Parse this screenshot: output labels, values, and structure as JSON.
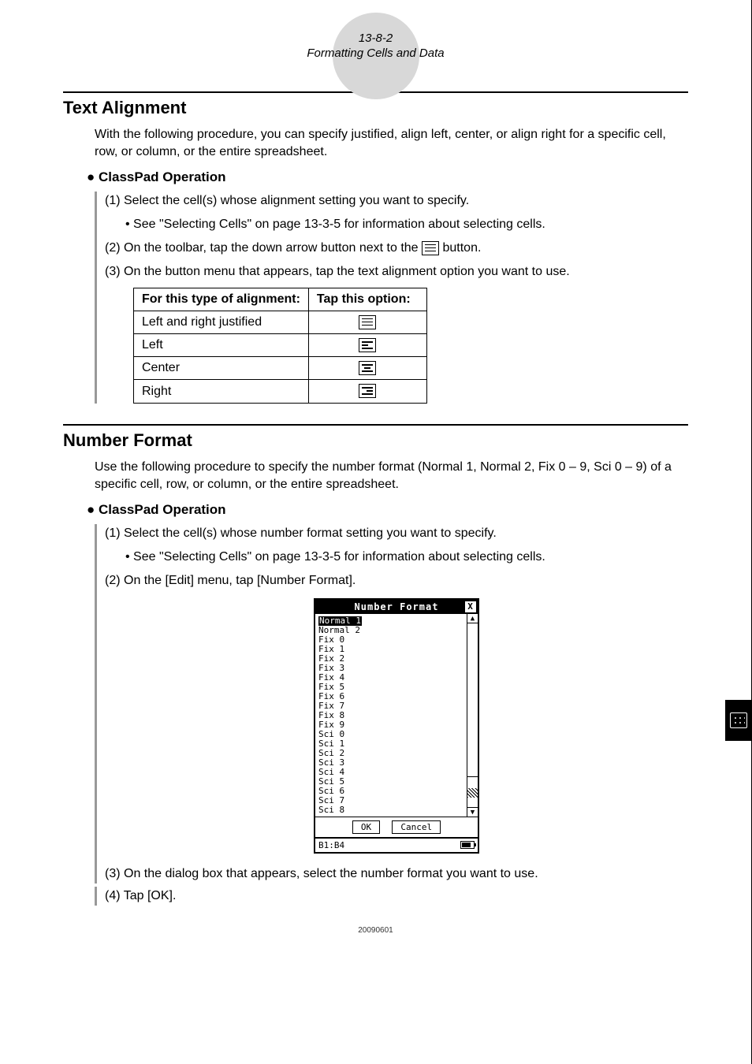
{
  "header": {
    "page_num": "13-8-2",
    "subtitle": "Formatting Cells and Data"
  },
  "section1": {
    "heading": "Text Alignment",
    "intro": "With the following procedure, you can specify justified, align left, center, or align right for a specific cell, row, or column, or the entire spreadsheet.",
    "op_heading": "ClassPad Operation",
    "step1": "(1) Select the cell(s) whose alignment setting you want to specify.",
    "step1_sub": "See \"Selecting Cells\" on page 13-3-5 for information about selecting cells.",
    "step2_a": "(2) On the toolbar, tap the down arrow button next to the ",
    "step2_b": " button.",
    "step3": "(3) On the button menu that appears, tap the text alignment option you want to use.",
    "table": {
      "h1": "For this type of alignment:",
      "h2": "Tap this option:",
      "r1": "Left and right justified",
      "r2": "Left",
      "r3": "Center",
      "r4": "Right"
    }
  },
  "section2": {
    "heading": "Number Format",
    "intro": "Use the following procedure to specify the number format (Normal 1, Normal 2, Fix 0 – 9, Sci 0 – 9) of a specific cell, row, or column, or the entire spreadsheet.",
    "op_heading": "ClassPad Operation",
    "step1": "(1) Select the cell(s) whose number format setting you want to specify.",
    "step1_sub": "See \"Selecting Cells\" on page 13-3-5 for information about selecting cells.",
    "step2": "(2) On the [Edit] menu, tap [Number Format].",
    "step3": "(3) On the dialog box that appears, select the number format you want to use.",
    "step4": "(4) Tap [OK]."
  },
  "dialog": {
    "title": "Number Format",
    "items": [
      "Normal 1",
      "Normal 2",
      "Fix 0",
      "Fix 1",
      "Fix 2",
      "Fix 3",
      "Fix 4",
      "Fix 5",
      "Fix 6",
      "Fix 7",
      "Fix 8",
      "Fix 9",
      "Sci 0",
      "Sci 1",
      "Sci 2",
      "Sci 3",
      "Sci 4",
      "Sci 5",
      "Sci 6",
      "Sci 7",
      "Sci 8"
    ],
    "ok": "OK",
    "cancel": "Cancel",
    "status": "B1:B4"
  },
  "footer": "20090601"
}
